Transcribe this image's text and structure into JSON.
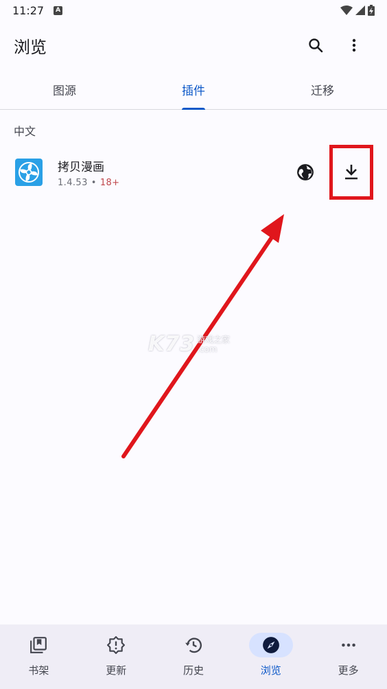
{
  "status_bar": {
    "time": "11:27",
    "notification_icon": "a-letter-icon",
    "icons": [
      "wifi-icon",
      "signal-icon",
      "battery-charging-icon"
    ]
  },
  "app_bar": {
    "title": "浏览",
    "actions": [
      "search-icon",
      "more-vert-icon"
    ]
  },
  "tabs": [
    {
      "label": "图源",
      "active": false
    },
    {
      "label": "插件",
      "active": true
    },
    {
      "label": "迁移",
      "active": false
    }
  ],
  "extensions": {
    "section_title": "中文",
    "items": [
      {
        "name": "拷贝漫画",
        "version": "1.4.53",
        "separator": "•",
        "age_rating": "18+",
        "icon": "fan-app-icon",
        "actions": [
          "web-icon",
          "download-icon"
        ]
      }
    ]
  },
  "watermark": {
    "logo": "K73",
    "line1": "游戏之家",
    "line2": ".com"
  },
  "bottom_nav": [
    {
      "label": "书架",
      "icon": "library-icon",
      "active": false
    },
    {
      "label": "更新",
      "icon": "alert-badge-icon",
      "active": false
    },
    {
      "label": "历史",
      "icon": "history-icon",
      "active": false
    },
    {
      "label": "浏览",
      "icon": "compass-icon",
      "active": true
    },
    {
      "label": "更多",
      "icon": "more-horiz-icon",
      "active": false
    }
  ],
  "colors": {
    "accent": "#0c58c8",
    "highlight": "#e0161c",
    "nav_background": "#efedf6",
    "background": "#fcfbff"
  }
}
